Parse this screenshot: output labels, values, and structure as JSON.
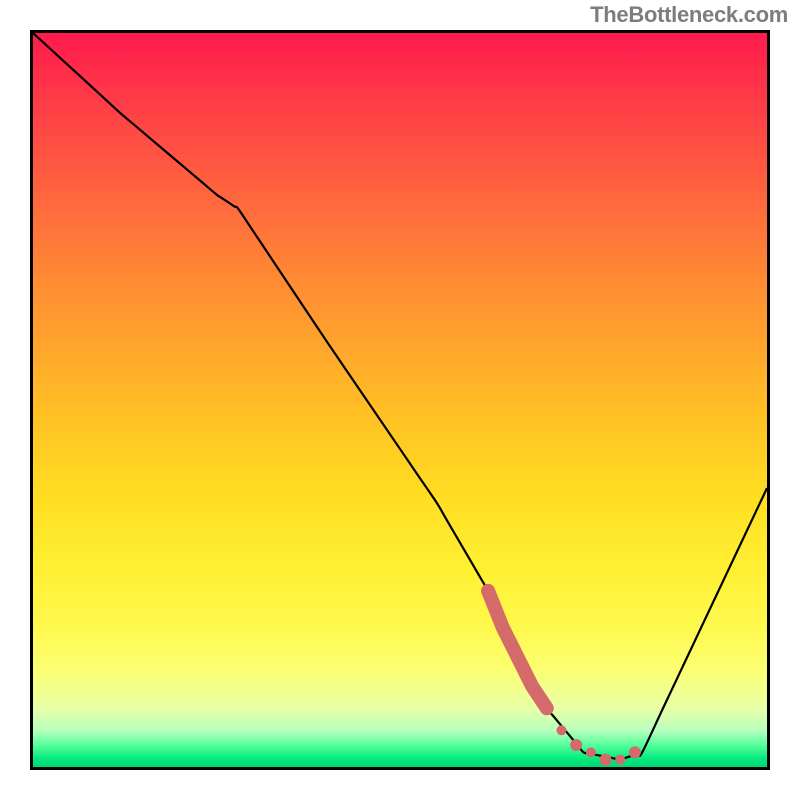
{
  "attribution": "TheBottleneck.com",
  "chart_data": {
    "type": "line",
    "title": "",
    "xlabel": "",
    "ylabel": "",
    "xlim": [
      0,
      100
    ],
    "ylim": [
      0,
      100
    ],
    "grid": false,
    "legend_visible": false,
    "series": [
      {
        "name": "bottleneck-curve",
        "color": "#000000",
        "x": [
          0,
          12,
          25,
          28,
          40,
          55,
          62,
          65,
          70,
          75,
          80,
          83,
          100
        ],
        "values": [
          100,
          89,
          78,
          76,
          58,
          36,
          24,
          18,
          8,
          2,
          1,
          2,
          38
        ]
      },
      {
        "name": "highlight-segment",
        "color": "#d46a6a",
        "x": [
          62,
          64,
          66,
          68,
          70,
          72,
          74,
          76,
          78,
          80,
          82
        ],
        "values": [
          24,
          19,
          15,
          11,
          8,
          5,
          3,
          2,
          1,
          1,
          2
        ]
      }
    ],
    "background_gradient": [
      {
        "pos": 0,
        "color": "#ff1a4d"
      },
      {
        "pos": 50,
        "color": "#ffc623"
      },
      {
        "pos": 85,
        "color": "#fbff73"
      },
      {
        "pos": 100,
        "color": "#00d873"
      }
    ]
  }
}
